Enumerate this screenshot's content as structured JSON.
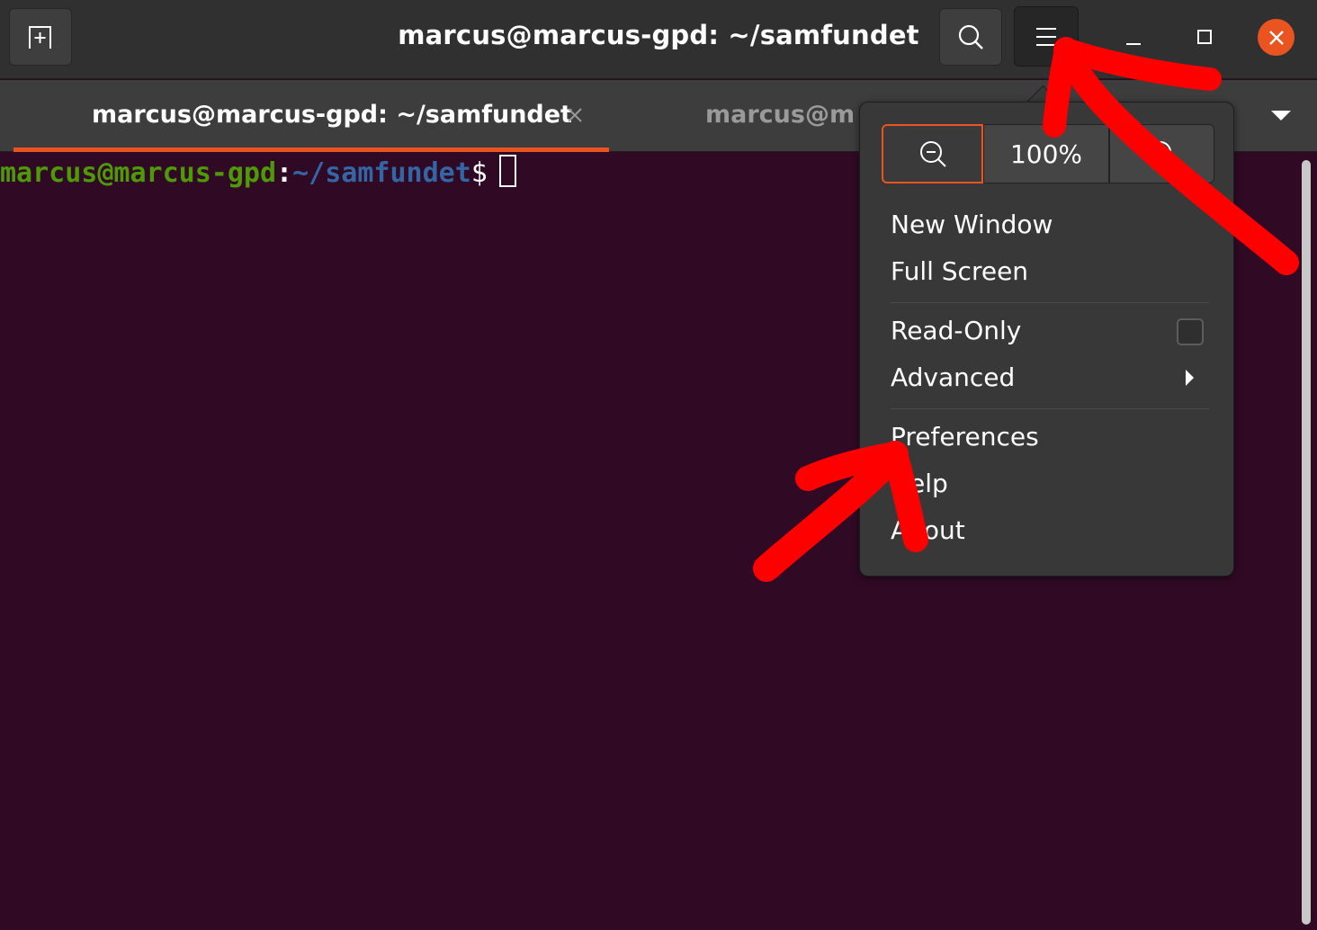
{
  "window": {
    "title": "marcus@marcus-gpd: ~/samfundet"
  },
  "tabs": [
    {
      "label": "marcus@marcus-gpd: ~/samfundet",
      "active": true
    },
    {
      "label": "marcus@ma",
      "active": false
    }
  ],
  "terminal": {
    "prompt_user": "marcus@marcus-gpd",
    "prompt_colon": ":",
    "prompt_path": "~/samfundet",
    "prompt_symbol": "$"
  },
  "menu": {
    "zoom_value": "100%",
    "items": [
      {
        "label": "New Window"
      },
      {
        "label": "Full Screen"
      },
      {
        "label": "Read-Only",
        "checked": false
      },
      {
        "label": "Advanced",
        "has_submenu": true
      },
      {
        "label": "Preferences"
      },
      {
        "label": "Help"
      },
      {
        "label": "About"
      }
    ]
  },
  "colors": {
    "accent": "#e95420",
    "terminal_bg": "#300a24",
    "annotation": "#ff0000"
  },
  "icons": {
    "new_tab": "new-tab-icon",
    "search": "search-icon",
    "hamburger": "hamburger-menu-icon",
    "minimize": "minimize-icon",
    "maximize": "maximize-icon",
    "close": "close-icon",
    "zoom_out": "zoom-out-icon",
    "zoom_in": "zoom-in-icon"
  }
}
